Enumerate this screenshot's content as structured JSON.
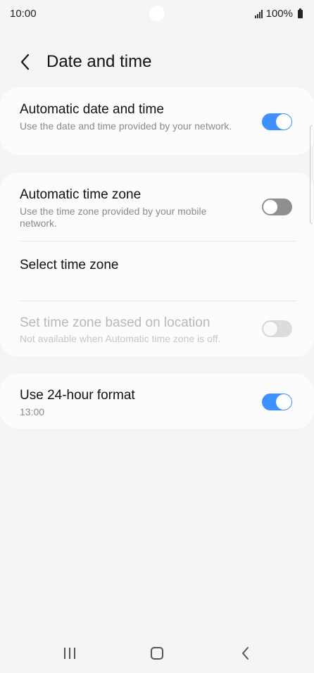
{
  "status_bar": {
    "time": "10:00",
    "battery": "100%"
  },
  "header": {
    "title": "Date and time",
    "back_icon": "chevron-left-icon"
  },
  "settings": {
    "auto_date_time": {
      "title": "Automatic date and time",
      "subtitle": "Use the date and time provided by your network.",
      "enabled": true
    },
    "auto_time_zone": {
      "title": "Automatic time zone",
      "subtitle": "Use the time zone provided by your mobile network.",
      "enabled": false
    },
    "select_time_zone": {
      "title": "Select time zone"
    },
    "location_time_zone": {
      "title": "Set time zone based on location",
      "subtitle": "Not available when Automatic time zone is off.",
      "enabled": false,
      "available": false
    },
    "format_24h": {
      "title": "Use 24-hour format",
      "subtitle": "13:00",
      "enabled": true
    }
  },
  "nav_bar": {
    "recent_icon": "recent-apps-icon",
    "home_icon": "home-icon",
    "back_icon": "back-icon"
  },
  "colors": {
    "accent": "#3e91ff",
    "background": "#f5f5f5",
    "card": "#fcfcfc"
  }
}
